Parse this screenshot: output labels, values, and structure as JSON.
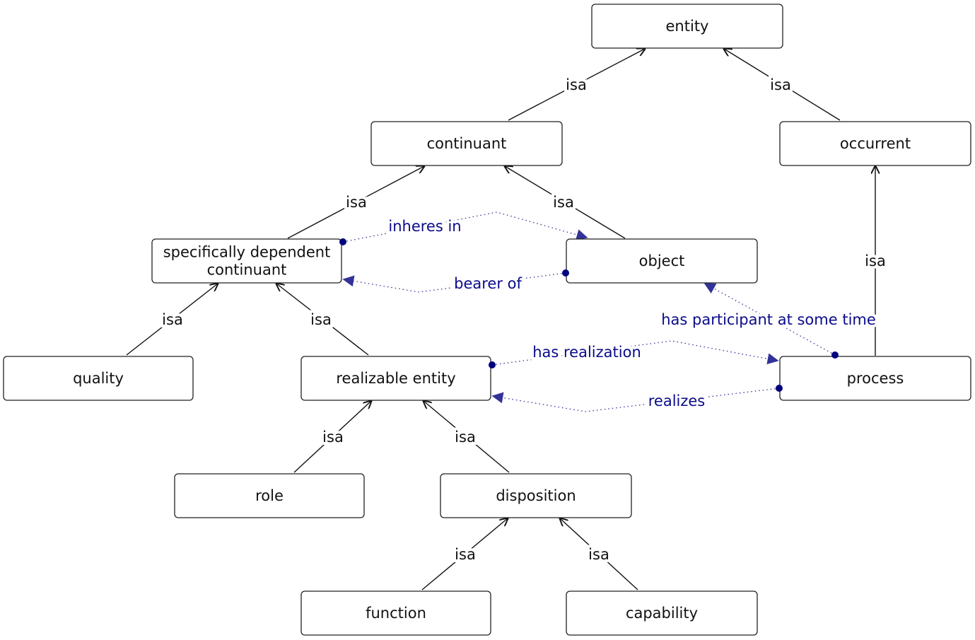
{
  "diagram": {
    "nodes": [
      {
        "id": "entity",
        "label": "entity"
      },
      {
        "id": "continuant",
        "label": "continuant"
      },
      {
        "id": "occurrent",
        "label": "occurrent"
      },
      {
        "id": "sdc",
        "label": "specifically dependent continuant"
      },
      {
        "id": "object",
        "label": "object"
      },
      {
        "id": "quality",
        "label": "quality"
      },
      {
        "id": "realizable",
        "label": "realizable entity"
      },
      {
        "id": "process",
        "label": "process"
      },
      {
        "id": "role",
        "label": "role"
      },
      {
        "id": "disposition",
        "label": "disposition"
      },
      {
        "id": "function",
        "label": "function"
      },
      {
        "id": "capability",
        "label": "capability"
      }
    ],
    "isa_edges": [
      {
        "from": "continuant",
        "to": "entity",
        "label": "isa"
      },
      {
        "from": "occurrent",
        "to": "entity",
        "label": "isa"
      },
      {
        "from": "sdc",
        "to": "continuant",
        "label": "isa"
      },
      {
        "from": "object",
        "to": "continuant",
        "label": "isa"
      },
      {
        "from": "process",
        "to": "occurrent",
        "label": "isa"
      },
      {
        "from": "quality",
        "to": "sdc",
        "label": "isa"
      },
      {
        "from": "realizable",
        "to": "sdc",
        "label": "isa"
      },
      {
        "from": "role",
        "to": "realizable",
        "label": "isa"
      },
      {
        "from": "disposition",
        "to": "realizable",
        "label": "isa"
      },
      {
        "from": "function",
        "to": "disposition",
        "label": "isa"
      },
      {
        "from": "capability",
        "to": "disposition",
        "label": "isa"
      }
    ],
    "relations": [
      {
        "from": "sdc",
        "to": "object",
        "label": "inheres in"
      },
      {
        "from": "object",
        "to": "sdc",
        "label": "bearer of"
      },
      {
        "from": "process",
        "to": "object",
        "label": "has participant at some time"
      },
      {
        "from": "realizable",
        "to": "process",
        "label": "has realization"
      },
      {
        "from": "process",
        "to": "realizable",
        "label": "realizes"
      }
    ],
    "colors": {
      "isa": "#111111",
      "relation": "#00007f"
    }
  }
}
